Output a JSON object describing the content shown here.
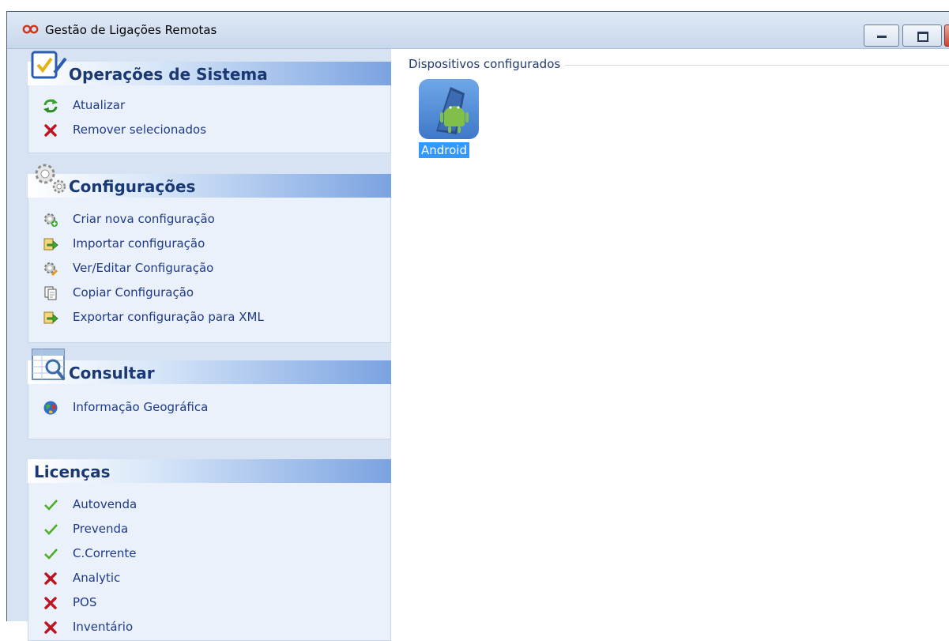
{
  "window": {
    "title": "Gestão de Ligações Remotas"
  },
  "sidebar": {
    "sections": [
      {
        "title": "Operações de Sistema",
        "items": [
          {
            "label": "Atualizar",
            "icon": "refresh-icon"
          },
          {
            "label": "Remover selecionados",
            "icon": "red-x-icon"
          }
        ]
      },
      {
        "title": "Configurações",
        "items": [
          {
            "label": "Criar nova configuração",
            "icon": "gear-add-icon"
          },
          {
            "label": "Importar configuração",
            "icon": "import-icon"
          },
          {
            "label": "Ver/Editar Configuração",
            "icon": "gear-edit-icon"
          },
          {
            "label": "Copiar Configuração",
            "icon": "copy-icon"
          },
          {
            "label": "Exportar configuração para XML",
            "icon": "export-icon"
          }
        ]
      },
      {
        "title": "Consultar",
        "items": [
          {
            "label": "Informação Geográfica",
            "icon": "globe-icon"
          }
        ]
      },
      {
        "title": "Licenças",
        "items": [
          {
            "label": "Autovenda",
            "icon": "check-icon"
          },
          {
            "label": "Prevenda",
            "icon": "check-icon"
          },
          {
            "label": "C.Corrente",
            "icon": "check-icon"
          },
          {
            "label": "Analytic",
            "icon": "red-x-icon"
          },
          {
            "label": "POS",
            "icon": "red-x-icon"
          },
          {
            "label": "Inventário",
            "icon": "red-x-icon"
          }
        ]
      }
    ]
  },
  "main": {
    "group_label": "Dispositivos configurados",
    "devices": [
      {
        "label": "Android",
        "icon": "android-device-icon",
        "selected": true
      }
    ]
  },
  "colors": {
    "link": "#1f3a88",
    "section_title": "#1a3873",
    "selection": "#3399ff",
    "check": "#4caf2a",
    "cross": "#c0111f"
  }
}
